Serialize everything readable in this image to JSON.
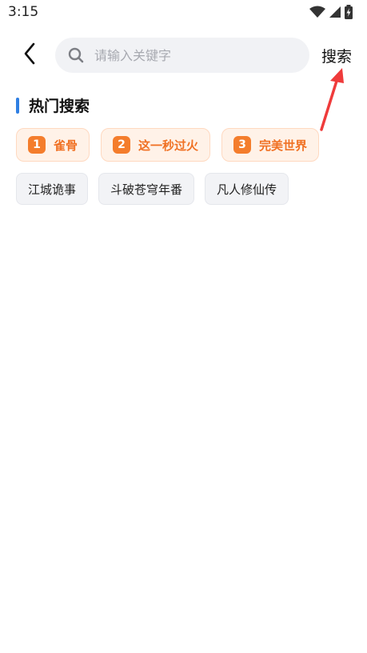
{
  "status_bar": {
    "time": "3:15",
    "icons": [
      "wifi-icon",
      "signal-icon",
      "battery-charging-icon"
    ]
  },
  "header": {
    "back_icon": "chevron-left-icon",
    "search_icon": "search-icon",
    "search_placeholder": "请输入关键字",
    "search_value": "",
    "search_button": "搜索"
  },
  "annotation": {
    "arrow_color": "#ef3b3b"
  },
  "hot_section": {
    "title": "热门搜索",
    "accent_color": "#2f7fe3",
    "ranked": [
      {
        "rank": "1",
        "label": "雀骨"
      },
      {
        "rank": "2",
        "label": "这一秒过火"
      },
      {
        "rank": "3",
        "label": "完美世界"
      }
    ],
    "others": [
      {
        "label": "江城诡事"
      },
      {
        "label": "斗破苍穹年番"
      },
      {
        "label": "凡人修仙传"
      }
    ]
  },
  "colors": {
    "hot_chip_bg": "#fff2e8",
    "hot_chip_text": "#f07124",
    "rank_badge": "#f47d2c",
    "normal_chip_bg": "#f2f3f6"
  }
}
